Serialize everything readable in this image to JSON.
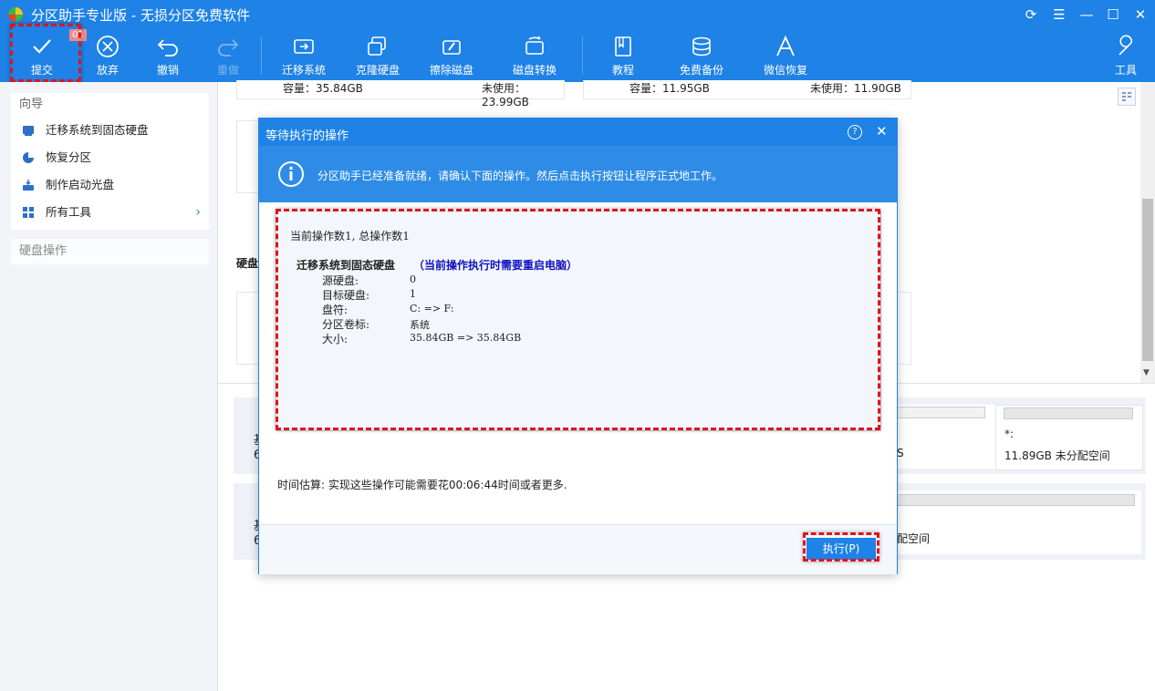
{
  "window": {
    "title": "分区助手专业版 - 无损分区免费软件"
  },
  "toolbar": {
    "commit": {
      "label": "提交",
      "badge": "01"
    },
    "discard": "放弃",
    "undo": "撤销",
    "redo": "重做",
    "migrate_os": "迁移系统",
    "clone_disk": "克隆硬盘",
    "wipe_disk": "擦除磁盘",
    "disk_convert": "磁盘转换",
    "tutorial": "教程",
    "free_backup": "免费备份",
    "wechat_restore": "微信恢复",
    "tools": "工具"
  },
  "sidebar": {
    "wizard_title": "向导",
    "items": [
      {
        "label": "迁移系统到固态硬盘",
        "icon": "migrate-icon"
      },
      {
        "label": "恢复分区",
        "icon": "recover-partition-icon"
      },
      {
        "label": "制作启动光盘",
        "icon": "bootable-disc-icon"
      },
      {
        "label": "所有工具",
        "icon": "all-tools-icon"
      }
    ],
    "disk_ops_title": "硬盘操作"
  },
  "background": {
    "disk1_capacity": "容量：35.84GB",
    "disk1_unused": "未使用：23.99GB",
    "disk2_capacity": "容量：11.95GB",
    "disk2_unused": "未使用：11.90GB",
    "disk_section_label": "硬盘",
    "partition_star": "*:",
    "unallocated": "11.89GB 未分配空间",
    "unallocated_partial": "配空间",
    "partial_s": "S",
    "row_prefix_1": "基",
    "row_num_1": "6",
    "row_prefix_2": "基",
    "row_num_2": "6"
  },
  "dialog": {
    "title": "等待执行的操作",
    "info": "分区助手已经准备就绪，请确认下面的操作。然后点击执行按钮让程序正式地工作。",
    "counts": "当前操作数1, 总操作数1",
    "op_title": "迁移系统到固态硬盘",
    "op_note": "（当前操作执行时需要重启电脑）",
    "details": [
      {
        "key": "源硬盘:",
        "value": "0"
      },
      {
        "key": "目标硬盘:",
        "value": "1"
      },
      {
        "key": "盘符:",
        "value": "C: => F:"
      },
      {
        "key": "分区卷标:",
        "value": "系统"
      },
      {
        "key": "大小:",
        "value": "35.84GB => 35.84GB"
      }
    ],
    "estimate": "时间估算: 实现这些操作可能需要花00:06:44时间或者更多.",
    "execute_label": "执行(P)"
  },
  "colors": {
    "accent": "#1e82e6",
    "highlight": "#e0141c",
    "note_blue": "#1010c0"
  }
}
